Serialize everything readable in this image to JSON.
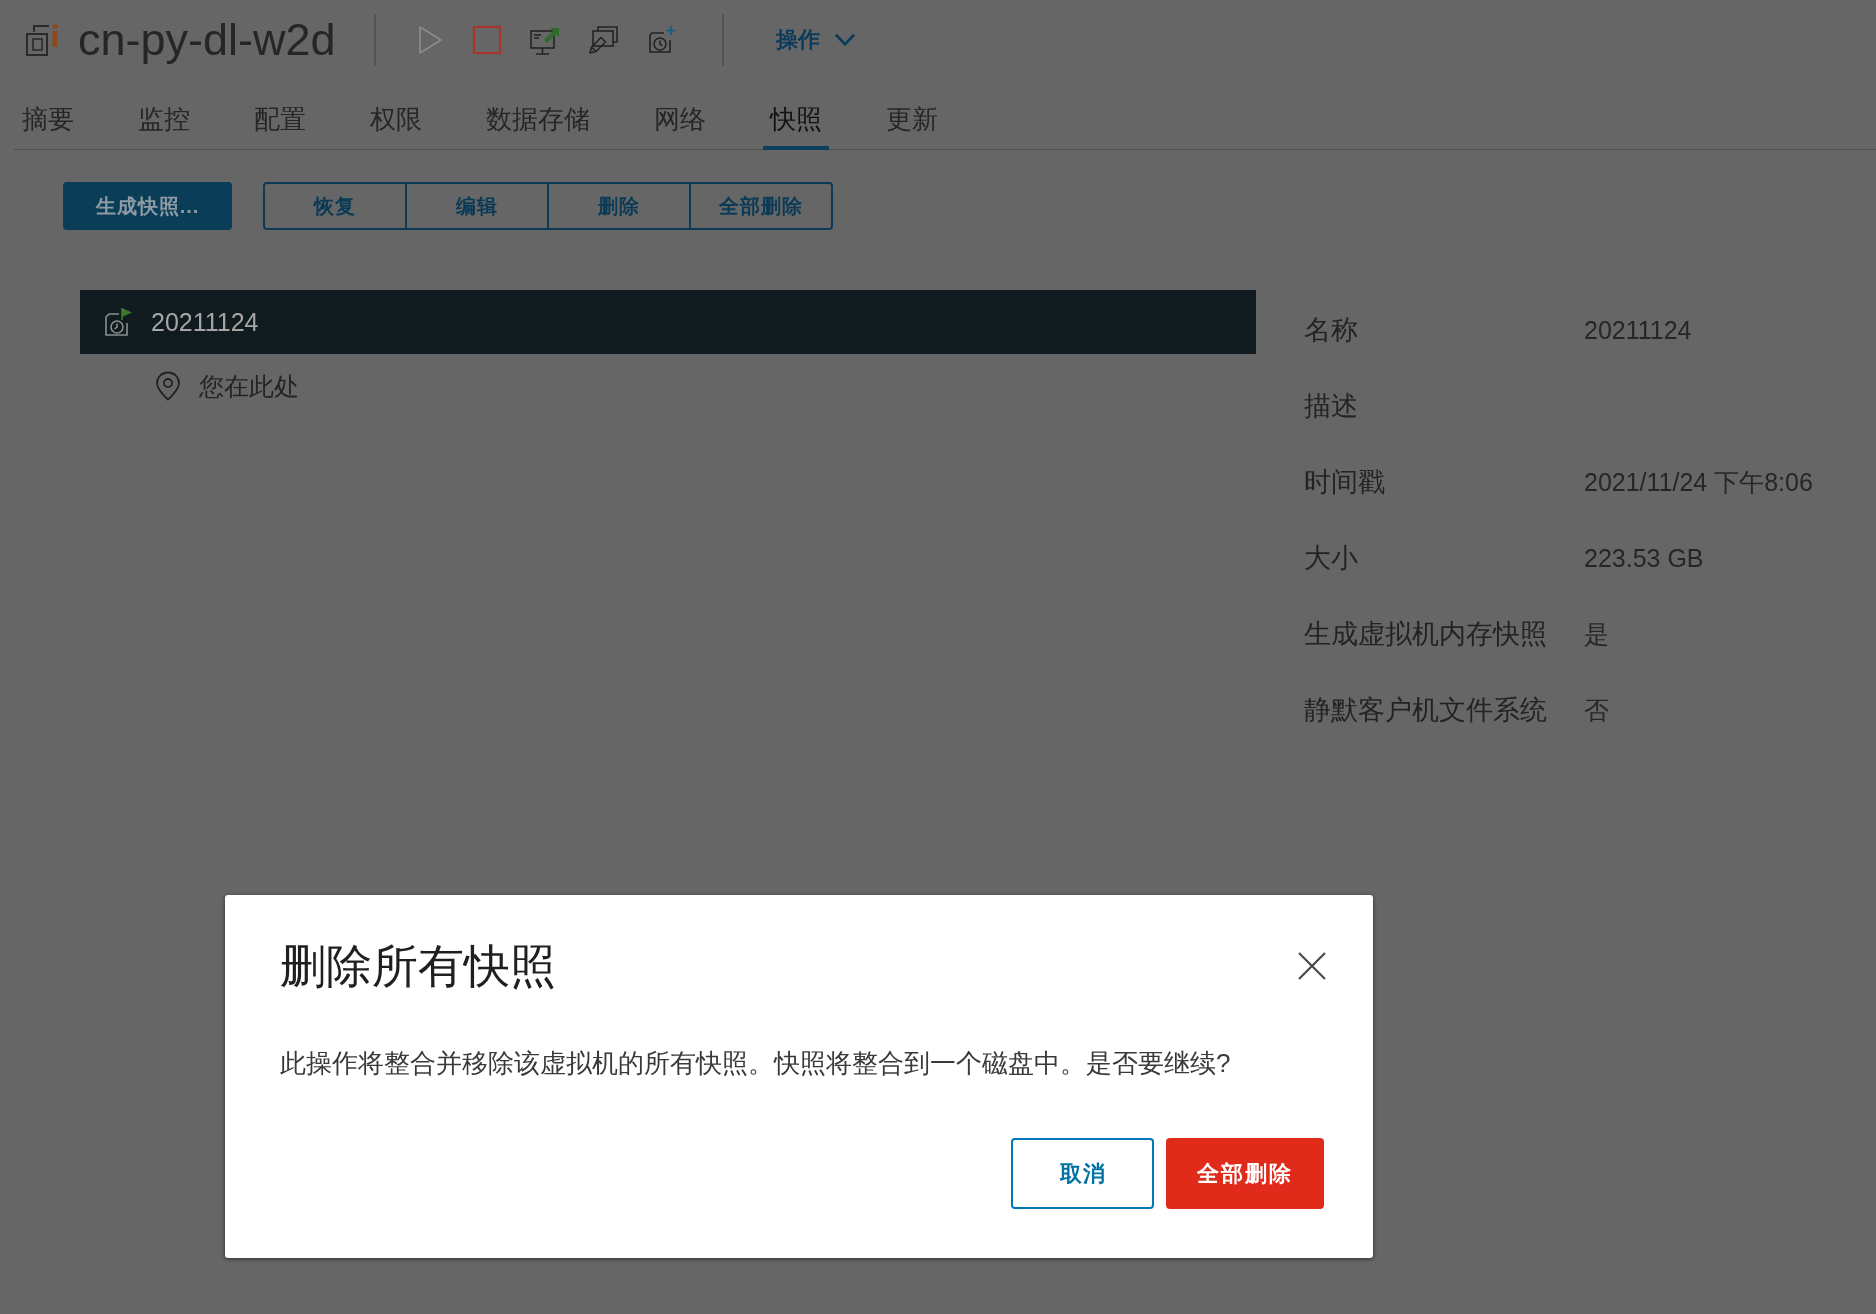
{
  "header": {
    "title": "cn-py-dl-w2d",
    "icon_buttons": [
      {
        "kind": "play",
        "disabled": true
      },
      {
        "kind": "stop",
        "disabled": false
      },
      {
        "kind": "console",
        "disabled": false
      },
      {
        "kind": "migrate",
        "disabled": false
      },
      {
        "kind": "snapshot",
        "disabled": false
      }
    ],
    "actions_menu": "操作"
  },
  "tabs": [
    {
      "label": "摘要",
      "selected": false
    },
    {
      "label": "监控",
      "selected": false
    },
    {
      "label": "配置",
      "selected": false
    },
    {
      "label": "权限",
      "selected": false
    },
    {
      "label": "数据存储",
      "selected": false
    },
    {
      "label": "网络",
      "selected": false
    },
    {
      "label": "快照",
      "selected": true
    },
    {
      "label": "更新",
      "selected": false
    }
  ],
  "toolbar": {
    "primary_button": "生成快照...",
    "button_group": [
      "恢复",
      "编辑",
      "删除",
      "全部删除"
    ]
  },
  "snapshot_tree": [
    {
      "kind": "snapshot",
      "label": "20211124",
      "selected": true,
      "children": [
        {
          "kind": "current",
          "label": "您在此处",
          "selected": false
        }
      ]
    }
  ],
  "details": [
    {
      "label": "名称",
      "value": "20211124"
    },
    {
      "label": "描述"
    },
    {
      "label": "时间戳",
      "value": "2021/11/24 下午8:06"
    },
    {
      "label": "大小",
      "value": "223.53 GB"
    },
    {
      "label": "生成虚拟机内存快照",
      "value": "是"
    },
    {
      "label": "静默客户机文件系统",
      "value": "否"
    }
  ],
  "dialog": {
    "title": "删除所有快照",
    "message": "此操作将整合并移除该虚拟机的所有快照。快照将整合到一个磁盘中。是否要继续?",
    "buttons": [
      {
        "kind": "secondary",
        "label": "取消"
      },
      {
        "kind": "danger",
        "label": "全部删除"
      }
    ]
  }
}
